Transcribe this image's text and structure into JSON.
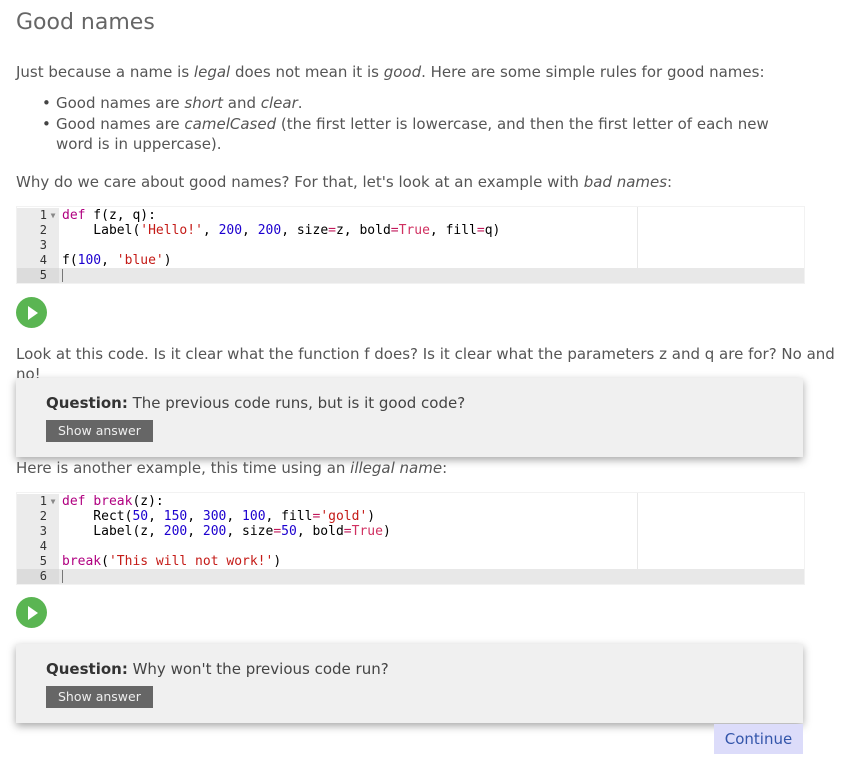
{
  "page": {
    "title": "Good names",
    "intro": {
      "before": "Just because a name is ",
      "legal": "legal",
      "middle": " does not mean it is ",
      "good": "good",
      "after": ". Here are some simple rules for good names:"
    },
    "rules": [
      {
        "before": "Good names are ",
        "em1": "short",
        "mid": " and ",
        "em2": "clear",
        "after": "."
      },
      {
        "before": "Good names are ",
        "em1": "camelCased",
        "after": " (the first letter is lowercase, and then the first letter of each new word is in uppercase)."
      }
    ],
    "why": {
      "before": "Why do we care about good names? For that, let's look at an example with ",
      "em": "bad names",
      "after": ":"
    },
    "look": "Look at this code. Is it clear what the function f does? Is it clear what the parameters z and q are for? No and no!",
    "another": {
      "before": "Here is another example, this time using an ",
      "em": "illegal name",
      "after": ":"
    }
  },
  "editor1": {
    "line_numbers": [
      "1",
      "2",
      "3",
      "4",
      "5"
    ]
  },
  "editor2": {
    "line_numbers": [
      "1",
      "2",
      "3",
      "4",
      "5",
      "6"
    ]
  },
  "question1": {
    "label": "Question:",
    "text": " The previous code runs, but is it good code?",
    "button": "Show answer"
  },
  "question2": {
    "label": "Question:",
    "text": " Why won't the previous code run?",
    "button": "Show answer"
  },
  "continue_label": "Continue",
  "colors": {
    "run_button": "#5ab552",
    "continue_bg": "#dcdcfa",
    "continue_text": "#3355aa"
  },
  "icons": {
    "run": "play-icon",
    "fold": "fold-arrow-icon"
  }
}
